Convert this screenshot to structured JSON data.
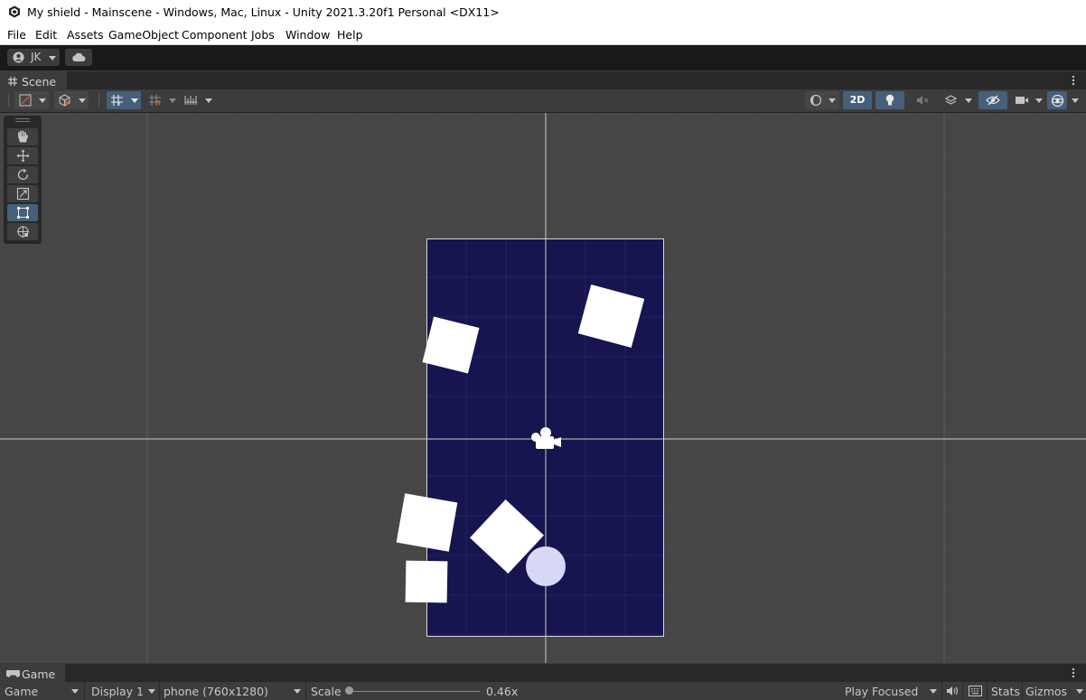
{
  "window": {
    "title": "My shield - Mainscene - Windows, Mac, Linux - Unity 2021.3.20f1 Personal <DX11>"
  },
  "menu": [
    "File",
    "Edit",
    "Assets",
    "GameObject",
    "Component",
    "Jobs",
    "Window",
    "Help"
  ],
  "account": {
    "label": "JK"
  },
  "scene_panel": {
    "tab_label": "Scene",
    "toolbar": {
      "mode_2d_label": "2D",
      "mode_2d_active": true,
      "gizmo_toggles": [
        "shading-mode",
        "lighting",
        "audio",
        "effects",
        "hidden-objects",
        "camera",
        "gizmos"
      ]
    },
    "tools": [
      "hand-tool",
      "move-tool",
      "rotate-tool",
      "scale-tool",
      "rect-tool",
      "transform-tool"
    ],
    "active_tool": "rect-tool",
    "canvas_color": "#16154f"
  },
  "game_panel": {
    "tab_label": "Game",
    "view_select": "Game",
    "display_select": "Display 1",
    "resolution_select": "phone (760x1280)",
    "scale_label": "Scale",
    "scale_value": "0.46x",
    "play_mode_select": "Play Focused",
    "stats_label": "Stats",
    "gizmos_label": "Gizmos"
  },
  "colors": {
    "accent_active": "#46607c",
    "background_canvas": "#16154f",
    "ball": "#d7d8f6"
  }
}
